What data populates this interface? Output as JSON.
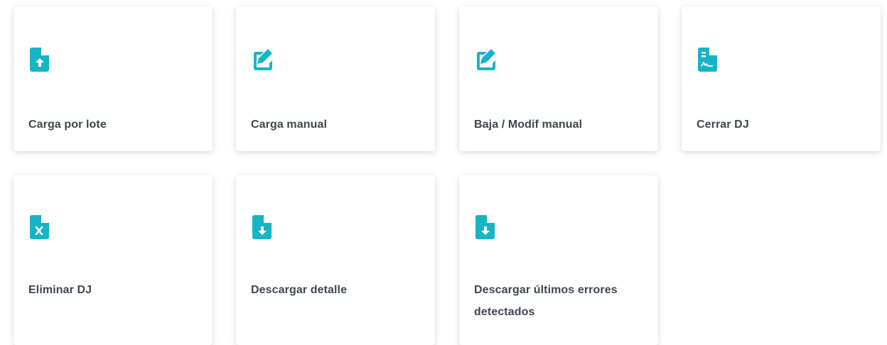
{
  "accent_color": "#19b3c6",
  "cards": [
    {
      "label": "Carga por lote",
      "icon": "file-upload-icon"
    },
    {
      "label": "Carga manual",
      "icon": "edit-icon"
    },
    {
      "label": "Baja / Modif manual",
      "icon": "edit-icon"
    },
    {
      "label": "Cerrar DJ",
      "icon": "file-signature-icon"
    },
    {
      "label": "Eliminar DJ",
      "icon": "file-delete-icon"
    },
    {
      "label": "Descargar detalle",
      "icon": "file-download-icon"
    },
    {
      "label": "Descargar últimos errores detectados",
      "icon": "file-download-icon"
    }
  ]
}
